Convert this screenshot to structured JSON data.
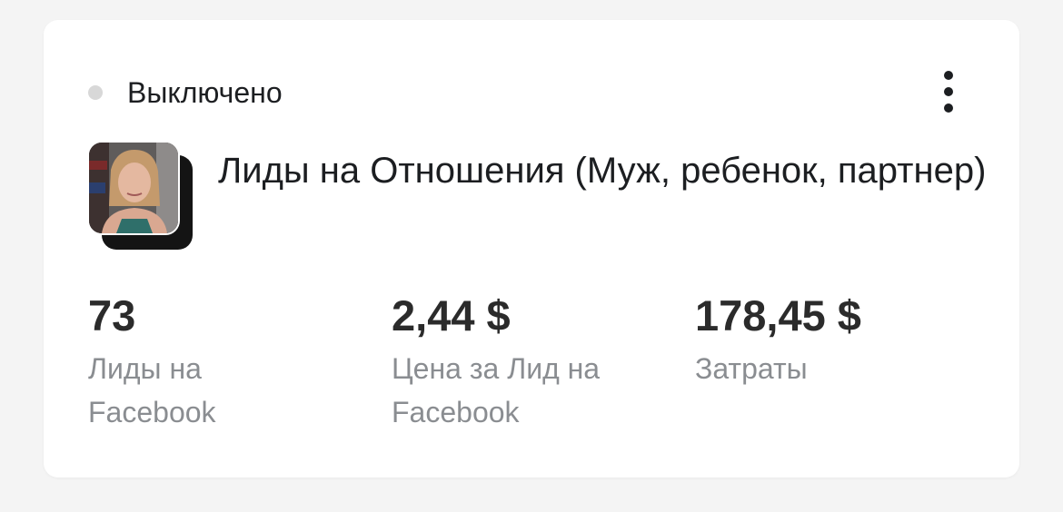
{
  "status": {
    "label": "Выключено",
    "dot_color": "#d8d8d8"
  },
  "menu": {
    "icon": "more-vertical-icon"
  },
  "campaign": {
    "title": "Лиды на Отношения (Муж, ребенок, партнер)",
    "thumbnail": "video-thumbnail-woman"
  },
  "metrics": [
    {
      "value": "73",
      "label": "Лиды на Facebook"
    },
    {
      "value": "2,44 $",
      "label": "Цена за Лид на Facebook"
    },
    {
      "value": "178,45 $",
      "label": "Затраты"
    }
  ]
}
